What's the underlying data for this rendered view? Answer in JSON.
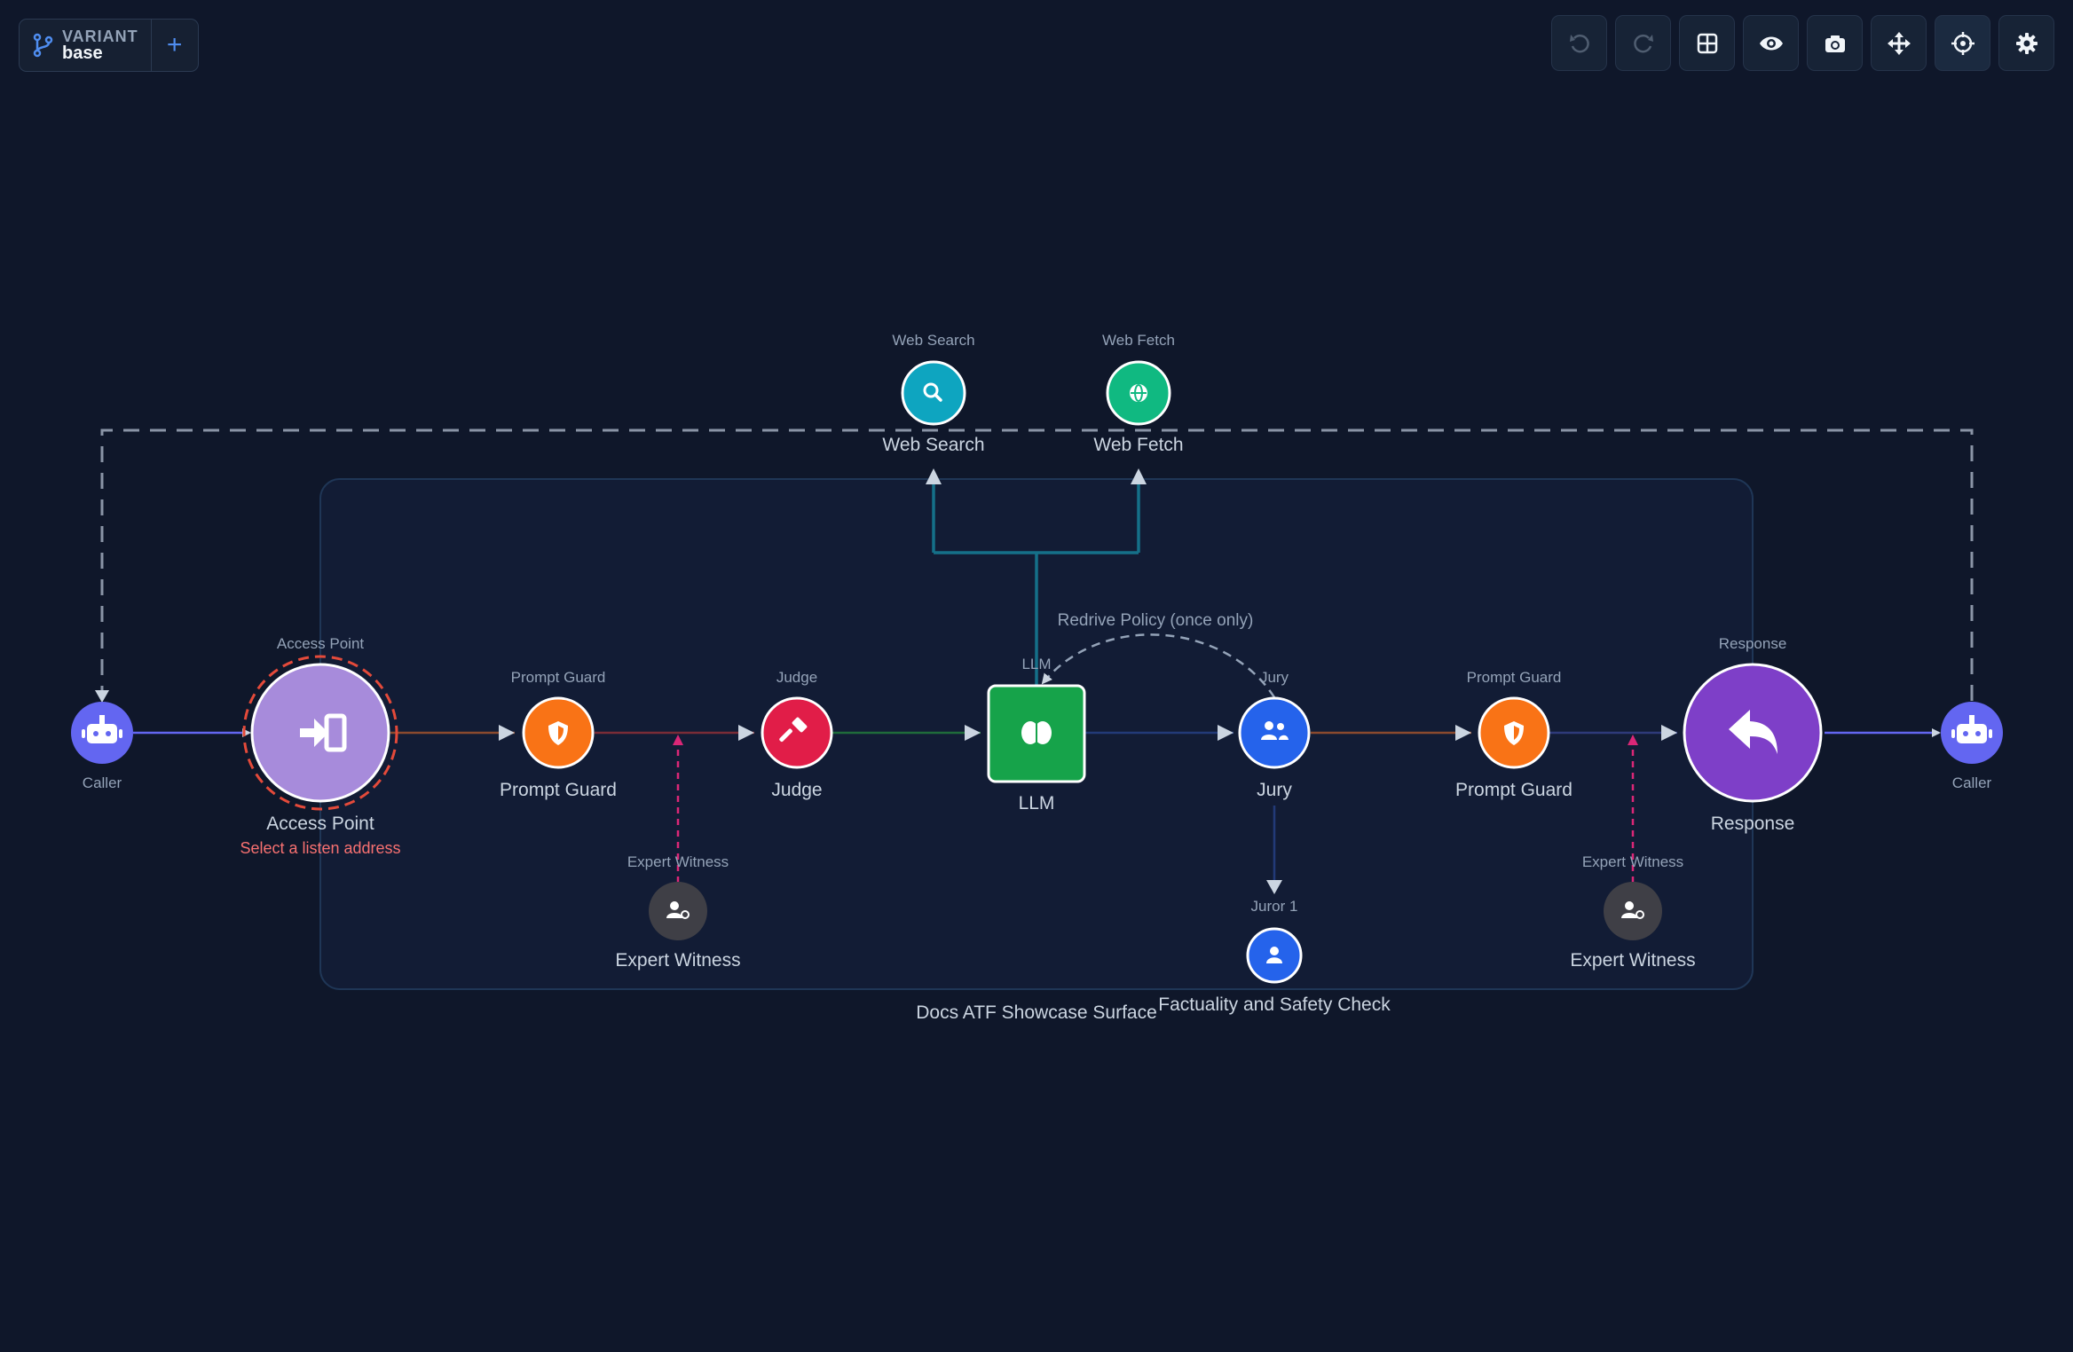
{
  "variant": {
    "label": "VARIANT",
    "name": "base",
    "add_label": "+"
  },
  "toolbar": [
    {
      "name": "undo-button",
      "icon": "undo-icon",
      "enabled": false
    },
    {
      "name": "redo-button",
      "icon": "redo-icon",
      "enabled": false
    },
    {
      "name": "grid-button",
      "icon": "grid-icon",
      "enabled": true
    },
    {
      "name": "preview-button",
      "icon": "eye-icon",
      "enabled": true
    },
    {
      "name": "screenshot-button",
      "icon": "camera-icon",
      "enabled": true
    },
    {
      "name": "pan-button",
      "icon": "move-icon",
      "enabled": true
    },
    {
      "name": "center-button",
      "icon": "crosshair-icon",
      "enabled": true
    },
    {
      "name": "settings-button",
      "icon": "gear-icon",
      "enabled": true
    }
  ],
  "surface": {
    "label": "Docs ATF Showcase Surface"
  },
  "nodes": {
    "caller_left": {
      "top": "",
      "label": "Caller"
    },
    "access_point": {
      "top": "Access Point",
      "label": "Access Point",
      "warning": "Select a listen address"
    },
    "prompt_guard_1": {
      "top": "Prompt Guard",
      "label": "Prompt Guard"
    },
    "judge": {
      "top": "Judge",
      "label": "Judge"
    },
    "llm": {
      "top": "LLM",
      "label": "LLM"
    },
    "jury": {
      "top": "Jury",
      "label": "Jury"
    },
    "prompt_guard_2": {
      "top": "Prompt Guard",
      "label": "Prompt Guard"
    },
    "response": {
      "top": "Response",
      "label": "Response"
    },
    "caller_right": {
      "top": "",
      "label": "Caller"
    },
    "web_search": {
      "top": "Web Search",
      "label": "Web Search"
    },
    "web_fetch": {
      "top": "Web Fetch",
      "label": "Web Fetch"
    },
    "expert_witness_1": {
      "top": "Expert Witness",
      "label": "Expert Witness"
    },
    "expert_witness_2": {
      "top": "Expert Witness",
      "label": "Expert Witness"
    },
    "juror_1": {
      "top": "Juror 1",
      "label": "Factuality and Safety Check"
    }
  },
  "edges": {
    "redrive_label": "Redrive Policy (once only)"
  },
  "colors": {
    "background": "#0f172a",
    "caller": "#6366f1",
    "access_point": "#a78bdb",
    "prompt_guard": "#f97316",
    "judge": "#e11d48",
    "llm": "#16a34a",
    "jury": "#2563eb",
    "response": "#7e3fc8",
    "web_search": "#0ea5c0",
    "web_fetch": "#10b981",
    "expert_witness": "#3f3f46",
    "warning": "#f87171",
    "dashed_magenta": "#db2777"
  }
}
